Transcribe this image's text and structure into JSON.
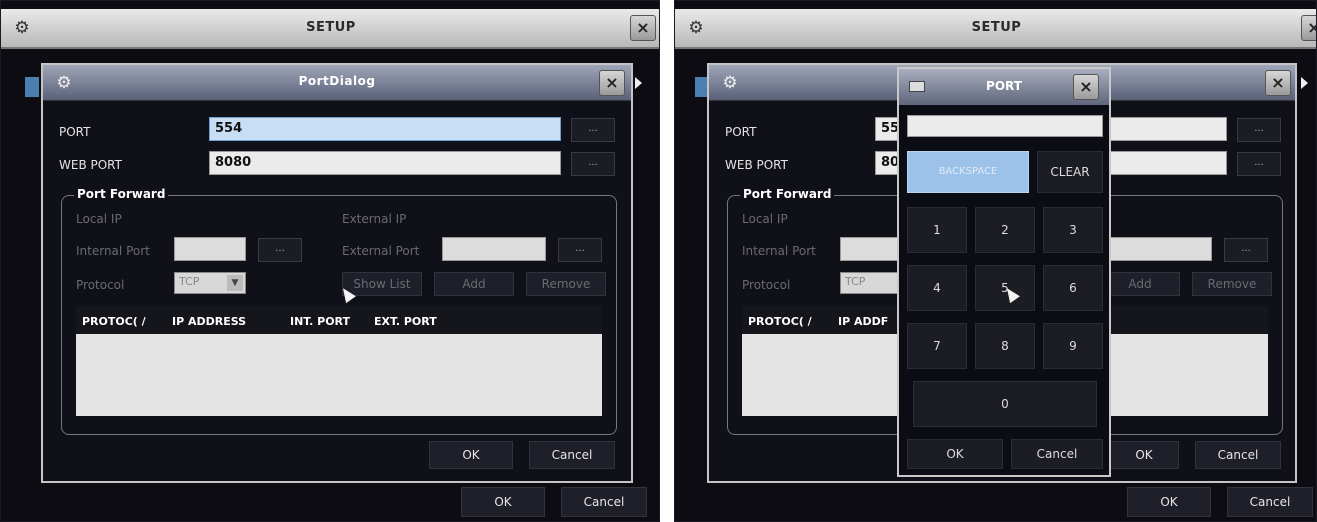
{
  "setup_title": "SETUP",
  "close_glyph": "×",
  "dots": "...",
  "left": {
    "dialog_title": "PortDialog",
    "port_label": "PORT",
    "port_value": "554",
    "web_port_label": "WEB PORT",
    "web_port_value": "8080",
    "group_title": "Port Forward",
    "local_ip": "Local IP",
    "external_ip": "External IP",
    "internal_port": "Internal Port",
    "external_port": "External Port",
    "protocol": "Protocol",
    "protocol_value": "TCP",
    "show_list": "Show List",
    "add": "Add",
    "remove": "Remove",
    "columns": [
      "PROTOC( /",
      "IP ADDRESS",
      "INT. PORT",
      "EXT. PORT"
    ],
    "ok": "OK",
    "cancel": "Cancel",
    "outer_ok": "OK",
    "outer_cancel": "Cancel"
  },
  "right": {
    "port_label": "PORT",
    "port_value_partial": "55",
    "web_port_label": "WEB PORT",
    "web_port_value_partial": "80",
    "group_title": "Port Forward",
    "local_ip": "Local IP",
    "internal_port": "Internal Port",
    "protocol": "Protocol",
    "protocol_value": "TCP",
    "add": "Add",
    "remove": "Remove",
    "columns": [
      "PROTOC( /",
      "IP ADDF"
    ],
    "ok": "OK",
    "cancel": "Cancel",
    "outer_ok": "OK",
    "outer_cancel": "Cancel",
    "keypad": {
      "title": "PORT",
      "backspace": "BACKSPACE",
      "clear": "CLEAR",
      "keys": [
        "1",
        "2",
        "3",
        "4",
        "5",
        "6",
        "7",
        "8",
        "9"
      ],
      "zero": "0",
      "ok": "OK",
      "cancel": "Cancel"
    }
  }
}
